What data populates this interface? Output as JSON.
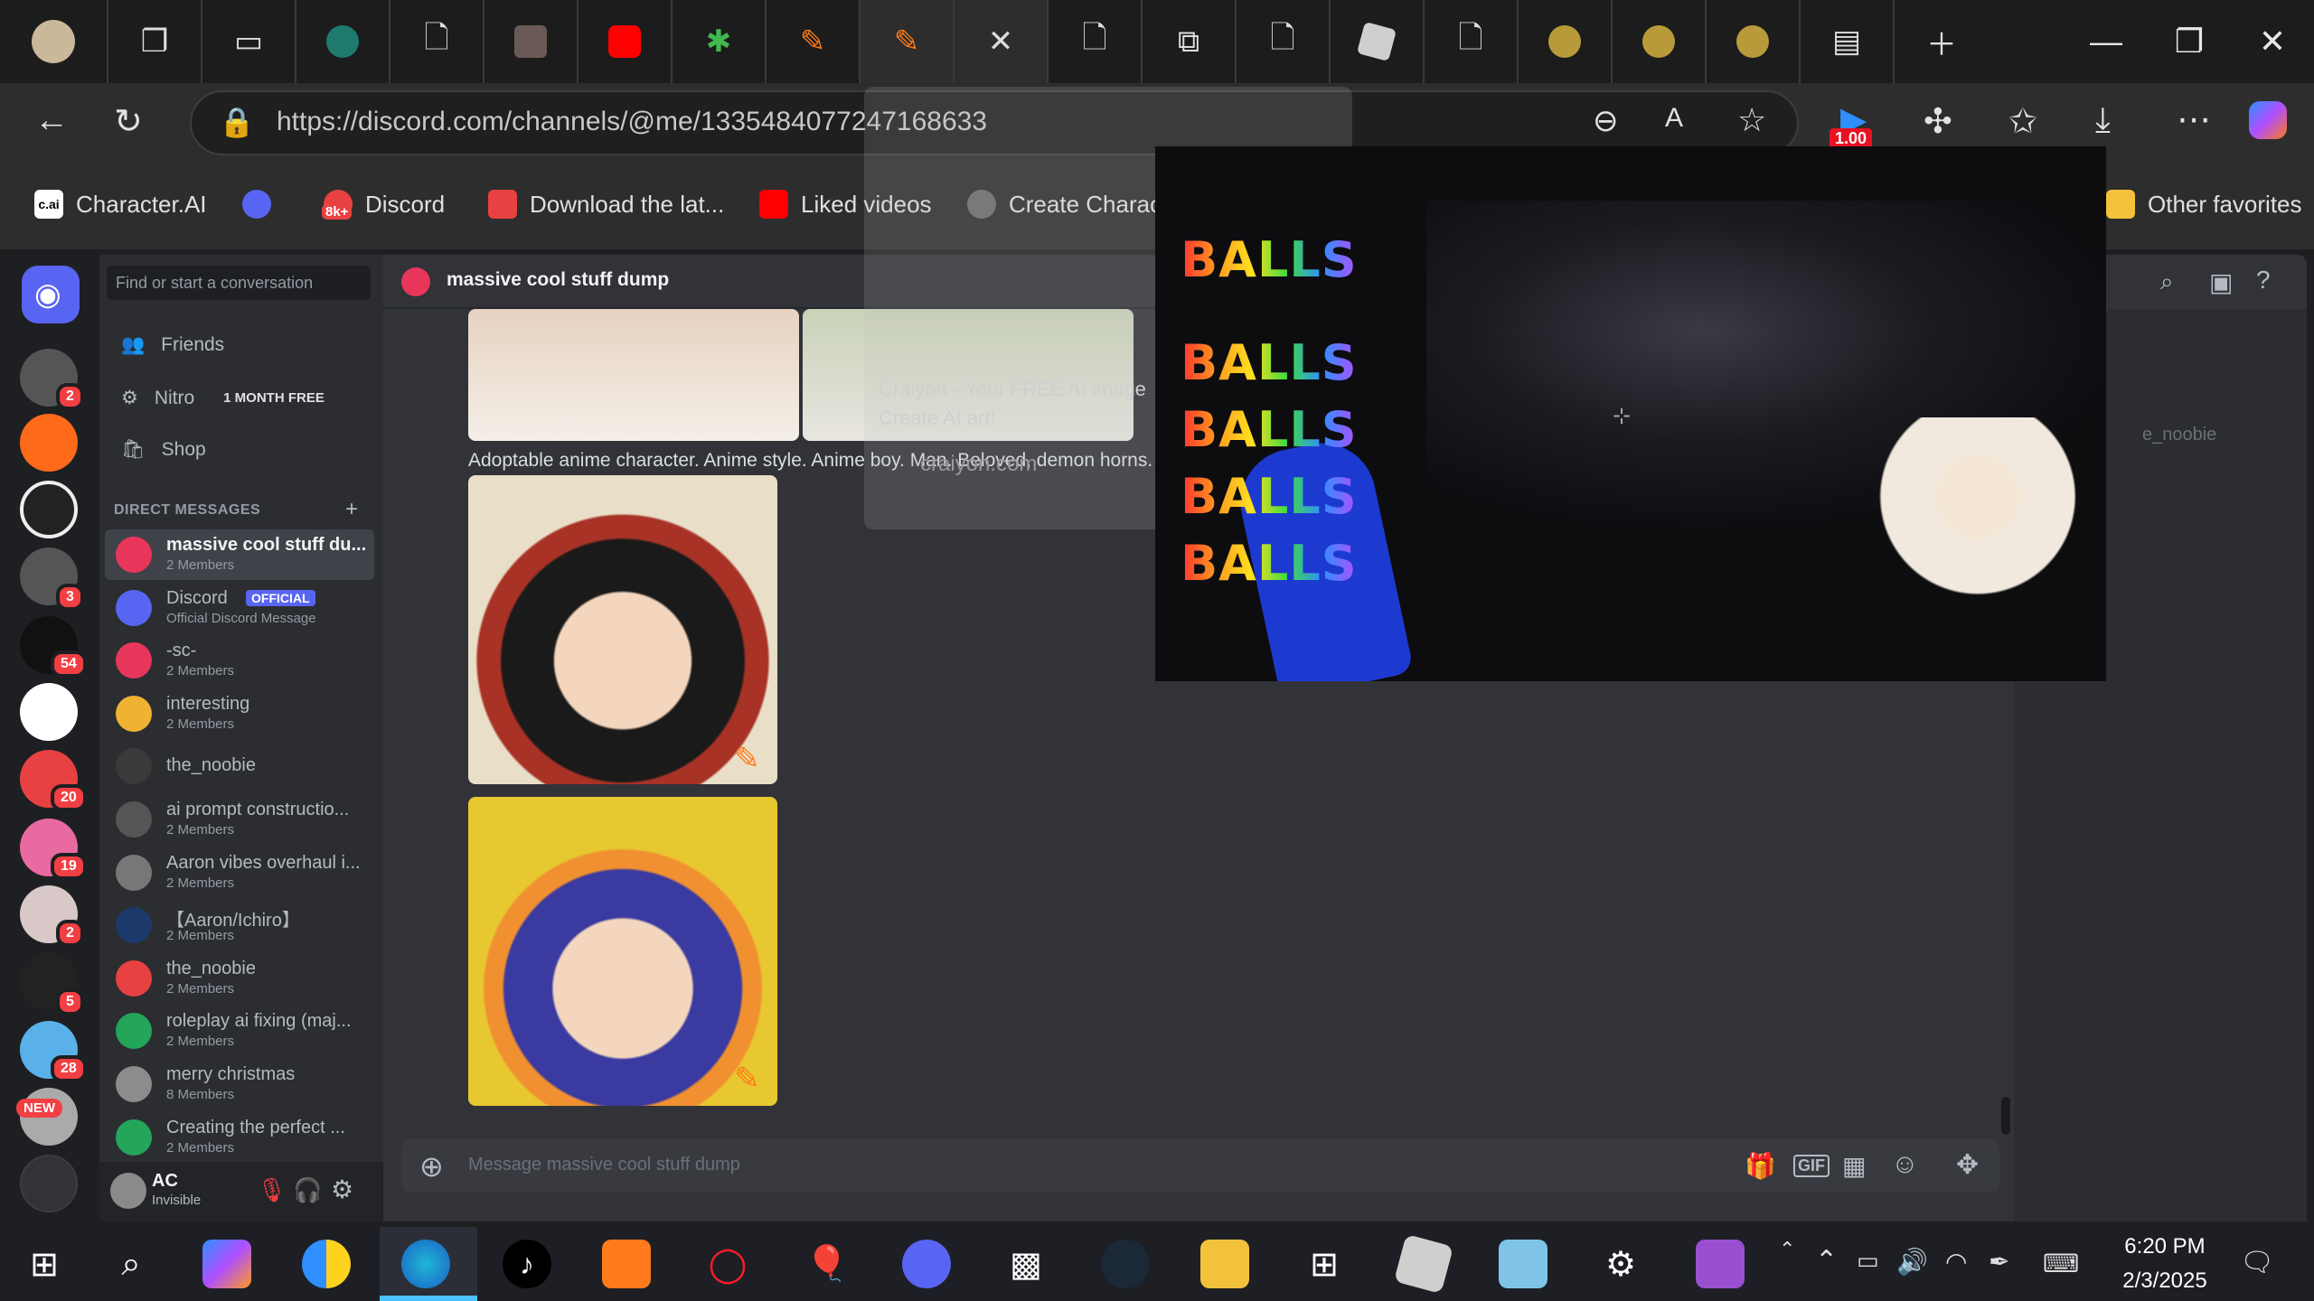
{
  "browser": {
    "url": "https://discord.com/channels/@me/1335484077247168633",
    "zoom_badge": "1.00",
    "favorites": [
      {
        "label": "Character.AI",
        "icon": "character-ai-icon"
      },
      {
        "label": "",
        "icon": "discord-icon"
      },
      {
        "label": "Discord",
        "icon": "discord-icon",
        "badge": "8k+"
      },
      {
        "label": "Download the lat...",
        "icon": "calendar-icon"
      },
      {
        "label": "Liked videos",
        "icon": "youtube-icon"
      },
      {
        "label": "Create Characte",
        "icon": "openai-icon"
      }
    ],
    "other_favorites": "Other favorites"
  },
  "discord": {
    "search_placeholder": "Find or start a conversation",
    "nav": {
      "friends": "Friends",
      "nitro": "Nitro",
      "nitro_badge": "1 MONTH FREE",
      "shop": "Shop"
    },
    "dm_header": "DIRECT MESSAGES",
    "dms": [
      {
        "name": "massive cool stuff du...",
        "sub": "2 Members",
        "color": "#e8365b"
      },
      {
        "name": "Discord",
        "sub": "Official Discord Message",
        "color": "#5865f2",
        "official": "OFFICIAL"
      },
      {
        "name": "-sc-",
        "sub": "2 Members",
        "color": "#e8365b"
      },
      {
        "name": "interesting",
        "sub": "2 Members",
        "color": "#f0b232"
      },
      {
        "name": "the_noobie",
        "sub": "",
        "color": "#3a3a3a"
      },
      {
        "name": "ai prompt constructio...",
        "sub": "2 Members",
        "color": "#555"
      },
      {
        "name": "Aaron vibes overhaul i...",
        "sub": "2 Members",
        "color": "#777"
      },
      {
        "name": "【Aaron/Ichiro】",
        "sub": "2 Members",
        "color": "#1b3a6b"
      },
      {
        "name": "the_noobie",
        "sub": "2 Members",
        "color": "#e84141"
      },
      {
        "name": "roleplay ai fixing (maj...",
        "sub": "2 Members",
        "color": "#23a55a"
      },
      {
        "name": "merry christmas",
        "sub": "8 Members",
        "color": "#8c8c8c"
      },
      {
        "name": "Creating the perfect ...",
        "sub": "2 Members",
        "color": "#23a55a"
      }
    ],
    "user": {
      "name": "AC",
      "status": "Invisible"
    },
    "channel_title": "massive cool stuff dump",
    "caption": "Adoptable anime character. Anime style. Anime boy. Man. Beloved, demon horns. in a",
    "message_placeholder": "Message massive cool stuff dump",
    "server_badges": [
      "2",
      "3",
      "54",
      "20",
      "19",
      "2",
      "5",
      "28"
    ],
    "new_label": "NEW",
    "members_fragment": "e_noobie"
  },
  "crayon": {
    "line1": "Craiyon - Your FREE AI image",
    "line2": "Create AI art!",
    "site": "craiyon.com"
  },
  "video": {
    "overlay_words": [
      "BALLS",
      "BALLS",
      "BALLS",
      "BALLS",
      "BALLS"
    ]
  },
  "taskbar": {
    "time": "6:20 PM",
    "date": "2/3/2025"
  }
}
